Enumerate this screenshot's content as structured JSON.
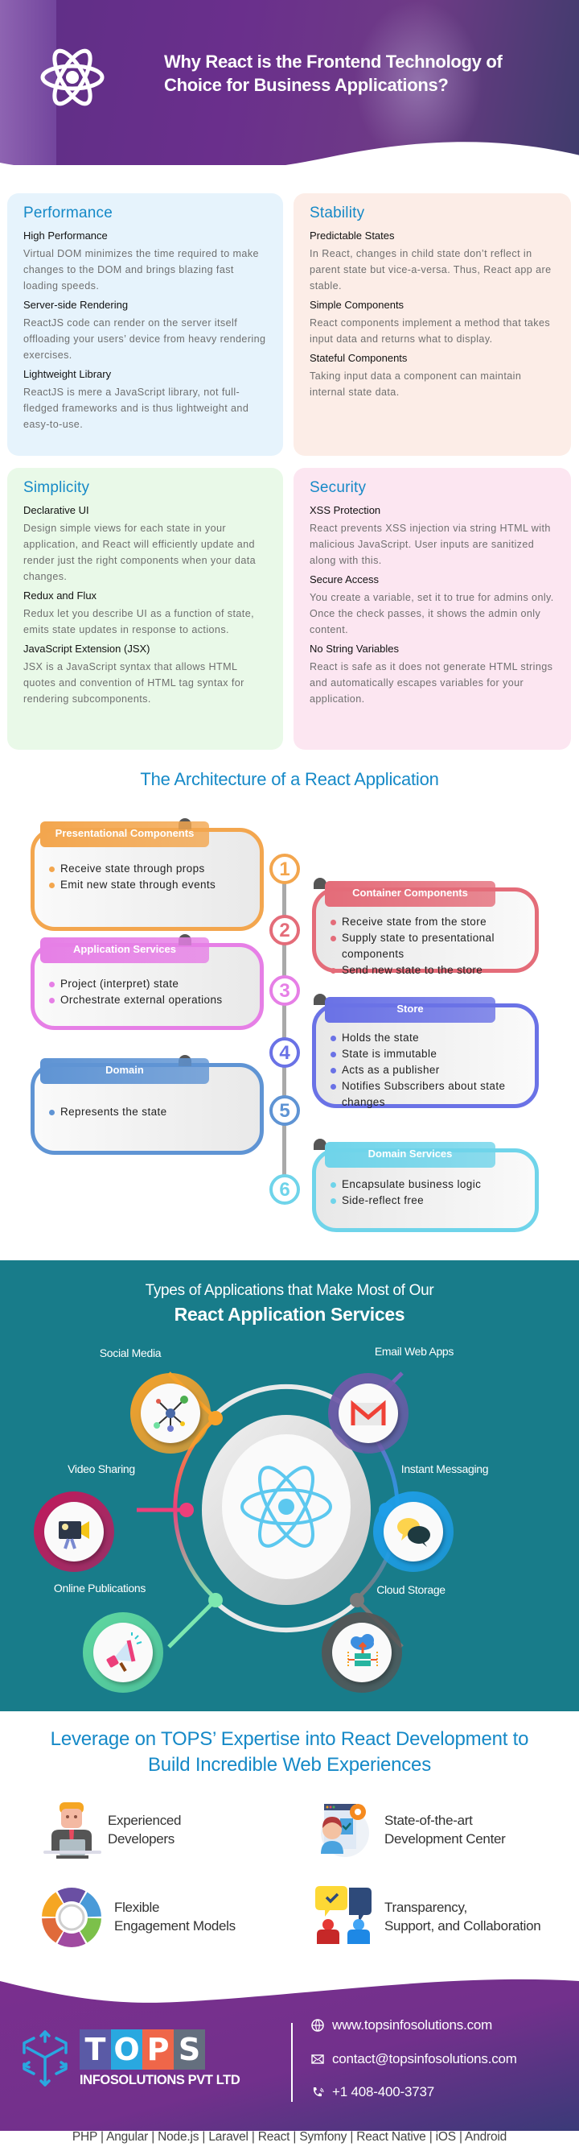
{
  "hero": {
    "title_line1": "Why React is the Frontend Technology of",
    "title_line2": "Choice for Business Applications?",
    "logo_icon": "react-atom-icon"
  },
  "cards": [
    {
      "title": "Performance",
      "bg": "#e6f3fc",
      "items": [
        {
          "heading": "High Performance",
          "text": "Virtual DOM minimizes the time required to make changes to the DOM and brings blazing fast loading speeds."
        },
        {
          "heading": "Server-side Rendering",
          "text": "ReactJS code can render on the server itself offloading your users’ device from heavy rendering exercises."
        },
        {
          "heading": "Lightweight Library",
          "text": "ReactJS is mere a JavaScript library, not full-fledged frameworks and is thus lightweight and easy-to-use."
        }
      ]
    },
    {
      "title": "Stability",
      "bg": "#fcede7",
      "items": [
        {
          "heading": "Predictable States",
          "text": "In React, changes in child state don’t reflect in parent state but vice-a-versa. Thus, React app are stable."
        },
        {
          "heading": "Simple Components",
          "text": "React components implement a method that takes input data and returns what to display."
        },
        {
          "heading": "Stateful Components",
          "text": "Taking input data a component can maintain internal state data."
        }
      ]
    },
    {
      "title": "Simplicity",
      "bg": "#e9f9e8",
      "items": [
        {
          "heading": "Declarative UI",
          "text": "Design simple views for each state in your application, and React will efficiently update and render just the right components when your data changes."
        },
        {
          "heading": "Redux and Flux",
          "text": "Redux let you describe UI as a function of state, emits state updates in response to actions."
        },
        {
          "heading": "JavaScript Extension (JSX)",
          "text": "JSX is a JavaScript syntax that allows HTML quotes and convention of HTML tag syntax for rendering subcomponents."
        }
      ]
    },
    {
      "title": "Security",
      "bg": "#fce6f1",
      "items": [
        {
          "heading": "XSS Protection",
          "text": "React prevents XSS injection via string HTML with malicious JavaScript. User inputs are sanitized along with this."
        },
        {
          "heading": "Secure Access",
          "text": "You create a variable, set it to true for admins only. Once the check passes, it shows the admin only content."
        },
        {
          "heading": "No String Variables",
          "text": "React is safe as it does not generate HTML strings and automatically escapes variables for your application."
        }
      ]
    }
  ],
  "architecture": {
    "title": "The Architecture of a React Application",
    "steps": [
      {
        "number": "1",
        "title": "Presentational Components",
        "color": "#f3a64e",
        "items": [
          "Receive state through props",
          "Emit new state through events"
        ]
      },
      {
        "number": "2",
        "title": "Container Components",
        "color": "#e46c79",
        "items": [
          "Receive state from the store",
          "Supply state to presentational components",
          "Send new state to the store"
        ]
      },
      {
        "number": "3",
        "title": "Application Services",
        "color": "#e67fe6",
        "items": [
          "Project (interpret) state",
          "Orchestrate external operations"
        ]
      },
      {
        "number": "4",
        "title": "Store",
        "color": "#6a72e6",
        "items": [
          "Holds the state",
          "State is immutable",
          "Acts as a publisher",
          "Notifies Subscribers about state changes"
        ]
      },
      {
        "number": "5",
        "title": "Domain",
        "color": "#5f94d4",
        "items": [
          "Represents the state"
        ]
      },
      {
        "number": "6",
        "title": "Domain Services",
        "color": "#6fd4ea",
        "items": [
          "Encapsulate business logic",
          "Side-reflect free"
        ]
      }
    ]
  },
  "applications": {
    "title_line1": "Types of Applications that Make Most of Our",
    "title_line2": "React Application Services",
    "bg": "#187c8a",
    "items": [
      {
        "label": "Social Media",
        "icon": "network-icon",
        "color": "#f7a22a"
      },
      {
        "label": "Email Web Apps",
        "icon": "gmail-icon",
        "color": "#6f5aa8"
      },
      {
        "label": "Video Sharing",
        "icon": "video-camera-icon",
        "color": "#c2185b"
      },
      {
        "label": "Instant Messaging",
        "icon": "chat-bubbles-icon",
        "color": "#1e9ee8"
      },
      {
        "label": "Online Publications",
        "icon": "megaphone-icon",
        "color": "#5fd8a0"
      },
      {
        "label": "Cloud Storage",
        "icon": "cloud-server-icon",
        "color": "#555555"
      }
    ],
    "center_icon": "react-atom-icon"
  },
  "leverage": {
    "title_line1": "Leverage on TOPS’ Expertise into React Development to",
    "title_line2": "Build Incredible Web Experiences",
    "features": [
      {
        "line1": "Experienced",
        "line2": "Developers",
        "icon": "developer-icon"
      },
      {
        "line1": "State-of-the-art",
        "line2": "Development Center",
        "icon": "development-center-icon"
      },
      {
        "line1": "Flexible",
        "line2": "Engagement Models",
        "icon": "engagement-wheel-icon"
      },
      {
        "line1": "Transparency,",
        "line2": "Support, and Collaboration",
        "icon": "collaboration-icon"
      }
    ]
  },
  "footer": {
    "brand_letters": [
      "T",
      "O",
      "P",
      "S"
    ],
    "brand_colors": [
      "#5a5aa6",
      "#29a8e0",
      "#ef6649",
      "#646f7e"
    ],
    "brand_sub": "INFOSOLUTIONS PVT LTD",
    "website": "www.topsinfosolutions.com",
    "email": "contact@topsinfosolutions.com",
    "phone": "+1 408-400-3737",
    "technologies": "PHP | Angular | Node.js | Laravel | React | Symfony | React Native | iOS | Android"
  }
}
